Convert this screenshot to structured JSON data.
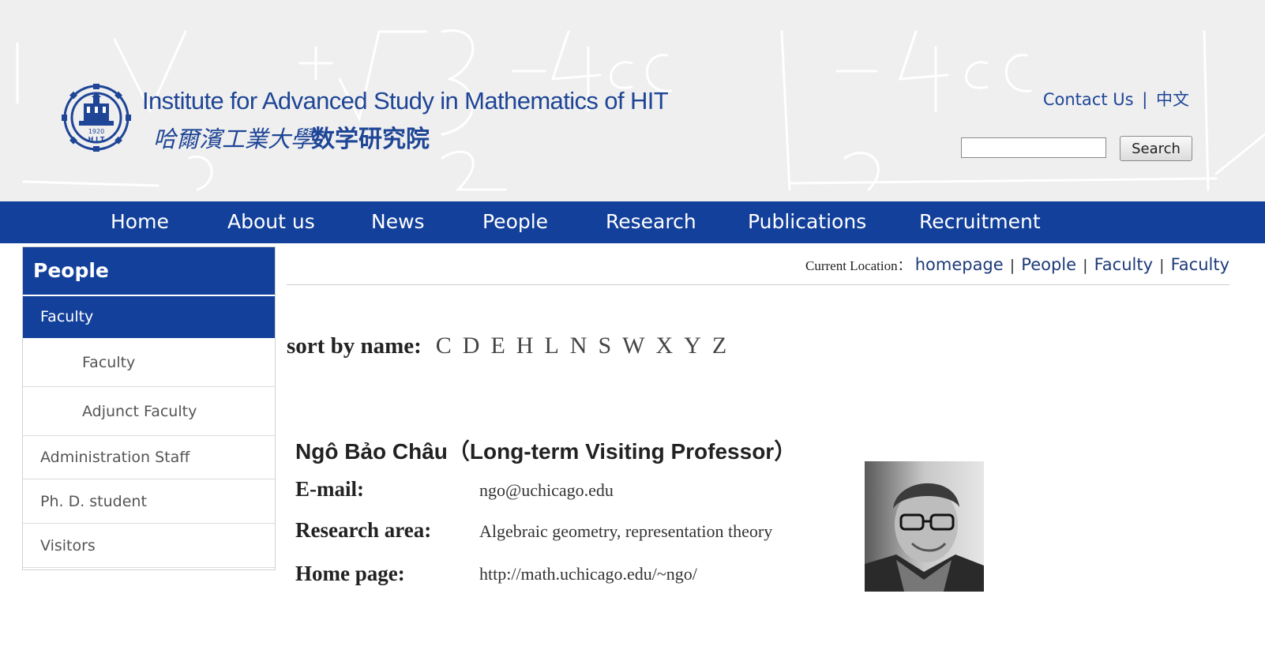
{
  "header": {
    "logo_en": "Institute for Advanced Study in Mathematics of HIT",
    "logo_zh_univ": "哈爾濱工業大學",
    "logo_zh_inst": "数学研究院",
    "seal_text": "1920",
    "seal_abbr": "H I T",
    "contact_label": "Contact Us",
    "separator": "|",
    "chinese_label": "中文",
    "search_placeholder": "",
    "search_button": "Search"
  },
  "nav": {
    "items": [
      "Home",
      "About us",
      "News",
      "People",
      "Research",
      "Publications",
      "Recruitment"
    ]
  },
  "sidebar": {
    "title": "People",
    "items": [
      {
        "label": "Faculty"
      },
      {
        "label": "Faculty"
      },
      {
        "label": "Adjunct Faculty"
      },
      {
        "label": "Administration Staff"
      },
      {
        "label": "Ph. D. student"
      },
      {
        "label": "Visitors"
      }
    ]
  },
  "location": {
    "label": "Current Location：",
    "crumbs": [
      "homepage",
      "People",
      "Faculty",
      "Faculty"
    ],
    "separator": "|"
  },
  "sort": {
    "label": "sort by name:",
    "letters": [
      "C",
      "D",
      "E",
      "H",
      "L",
      "N",
      "S",
      "W",
      "X",
      "Y",
      "Z"
    ]
  },
  "profile": {
    "name": "Ngô Bảo Châu（Long-term Visiting   Professor）",
    "email_label": "E-mail:",
    "email_value": "ngo@uchicago.edu",
    "research_label": "Research area:",
    "research_value": "Algebraic geometry, representation theory",
    "homepage_label": "Home page:",
    "homepage_value": "http://math.uchicago.edu/~ngo/"
  },
  "colors": {
    "brand_blue": "#13409b",
    "logo_blue": "#1e4596",
    "header_bg": "#efefef"
  }
}
